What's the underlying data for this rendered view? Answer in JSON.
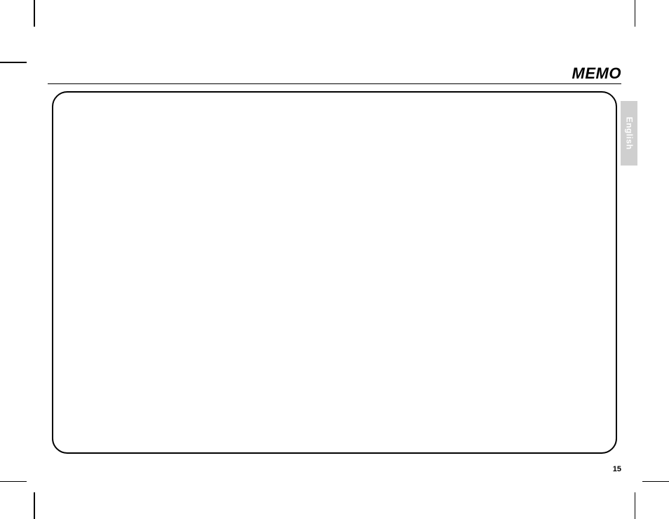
{
  "header": {
    "title": "MEMO"
  },
  "sidebar": {
    "language_tab": "English"
  },
  "footer": {
    "page_number": "15"
  }
}
